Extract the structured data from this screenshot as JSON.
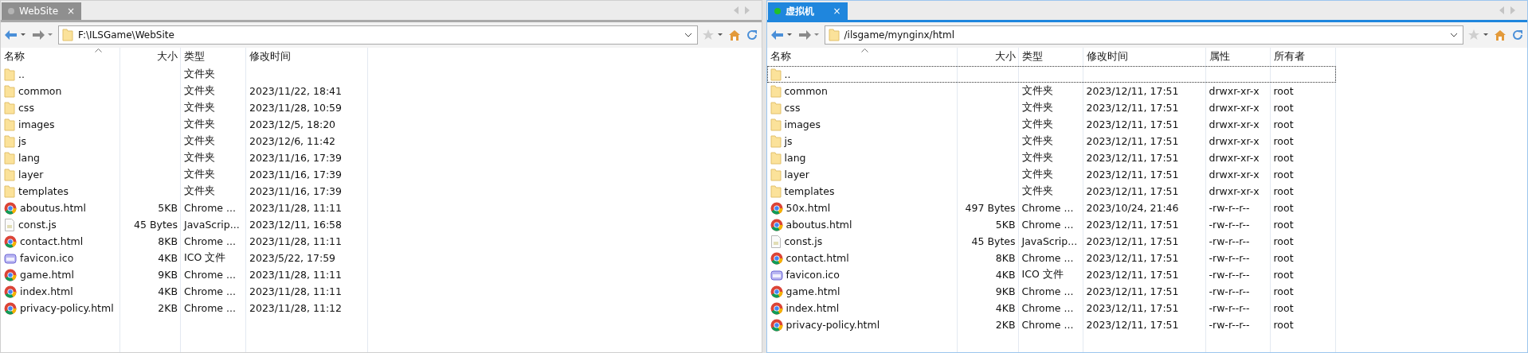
{
  "panels": [
    {
      "active": false,
      "tab": {
        "label": "WebSite",
        "color": "#b4b4b4",
        "close": "×"
      },
      "path": "F:\\ILSGame\\WebSite",
      "columns": [
        {
          "label": "名称",
          "sorted": true
        },
        {
          "label": "大小",
          "sorted": false
        },
        {
          "label": "类型",
          "sorted": false
        },
        {
          "label": "修改时间",
          "sorted": false
        }
      ],
      "rows": [
        {
          "kind": "folder",
          "name": "..",
          "type": "文件夹",
          "focused": false
        },
        {
          "kind": "folder",
          "name": "common",
          "type": "文件夹",
          "modified": "2023/11/22, 18:41",
          "focused": false
        },
        {
          "kind": "folder",
          "name": "css",
          "type": "文件夹",
          "modified": "2023/11/28, 10:59",
          "focused": false
        },
        {
          "kind": "folder",
          "name": "images",
          "type": "文件夹",
          "modified": "2023/12/5, 18:20",
          "focused": false
        },
        {
          "kind": "folder",
          "name": "js",
          "type": "文件夹",
          "modified": "2023/12/6, 11:42",
          "focused": false
        },
        {
          "kind": "folder",
          "name": "lang",
          "type": "文件夹",
          "modified": "2023/11/16, 17:39",
          "focused": false
        },
        {
          "kind": "folder",
          "name": "layer",
          "type": "文件夹",
          "modified": "2023/11/16, 17:39",
          "focused": false
        },
        {
          "kind": "folder",
          "name": "templates",
          "type": "文件夹",
          "modified": "2023/11/16, 17:39",
          "focused": false
        },
        {
          "kind": "chrome",
          "name": "aboutus.html",
          "size": "5KB",
          "type": "Chrome ...",
          "modified": "2023/11/28, 11:11",
          "focused": false
        },
        {
          "kind": "js",
          "name": "const.js",
          "size": "45 Bytes",
          "type": "JavaScrip...",
          "modified": "2023/12/11, 16:58",
          "focused": false
        },
        {
          "kind": "chrome",
          "name": "contact.html",
          "size": "8KB",
          "type": "Chrome ...",
          "modified": "2023/11/28, 11:11",
          "focused": false
        },
        {
          "kind": "ico",
          "name": "favicon.ico",
          "size": "4KB",
          "type": "ICO 文件",
          "modified": "2023/5/22, 17:59",
          "focused": false
        },
        {
          "kind": "chrome",
          "name": "game.html",
          "size": "9KB",
          "type": "Chrome ...",
          "modified": "2023/11/28, 11:11",
          "focused": false
        },
        {
          "kind": "chrome",
          "name": "index.html",
          "size": "4KB",
          "type": "Chrome ...",
          "modified": "2023/11/28, 11:11",
          "focused": false
        },
        {
          "kind": "chrome",
          "name": "privacy-policy.html",
          "size": "2KB",
          "type": "Chrome ...",
          "modified": "2023/11/28, 11:12",
          "focused": false
        }
      ]
    },
    {
      "active": true,
      "tab": {
        "label": "虚拟机",
        "color": "#22c02a",
        "close": "×"
      },
      "path": "/ilsgame/mynginx/html",
      "columns": [
        {
          "label": "名称",
          "sorted": true
        },
        {
          "label": "大小",
          "sorted": false
        },
        {
          "label": "类型",
          "sorted": false
        },
        {
          "label": "修改时间",
          "sorted": false
        },
        {
          "label": "属性",
          "sorted": false
        },
        {
          "label": "所有者",
          "sorted": false
        }
      ],
      "rows": [
        {
          "kind": "folder",
          "name": "..",
          "focused": true
        },
        {
          "kind": "folder",
          "name": "common",
          "type": "文件夹",
          "modified": "2023/12/11, 17:51",
          "permissions": "drwxr-xr-x",
          "owner": "root",
          "focused": false
        },
        {
          "kind": "folder",
          "name": "css",
          "type": "文件夹",
          "modified": "2023/12/11, 17:51",
          "permissions": "drwxr-xr-x",
          "owner": "root",
          "focused": false
        },
        {
          "kind": "folder",
          "name": "images",
          "type": "文件夹",
          "modified": "2023/12/11, 17:51",
          "permissions": "drwxr-xr-x",
          "owner": "root",
          "focused": false
        },
        {
          "kind": "folder",
          "name": "js",
          "type": "文件夹",
          "modified": "2023/12/11, 17:51",
          "permissions": "drwxr-xr-x",
          "owner": "root",
          "focused": false
        },
        {
          "kind": "folder",
          "name": "lang",
          "type": "文件夹",
          "modified": "2023/12/11, 17:51",
          "permissions": "drwxr-xr-x",
          "owner": "root",
          "focused": false
        },
        {
          "kind": "folder",
          "name": "layer",
          "type": "文件夹",
          "modified": "2023/12/11, 17:51",
          "permissions": "drwxr-xr-x",
          "owner": "root",
          "focused": false
        },
        {
          "kind": "folder",
          "name": "templates",
          "type": "文件夹",
          "modified": "2023/12/11, 17:51",
          "permissions": "drwxr-xr-x",
          "owner": "root",
          "focused": false
        },
        {
          "kind": "chrome",
          "name": "50x.html",
          "size": "497 Bytes",
          "type": "Chrome ...",
          "modified": "2023/10/24, 21:46",
          "permissions": "-rw-r--r--",
          "owner": "root",
          "focused": false
        },
        {
          "kind": "chrome",
          "name": "aboutus.html",
          "size": "5KB",
          "type": "Chrome ...",
          "modified": "2023/12/11, 17:51",
          "permissions": "-rw-r--r--",
          "owner": "root",
          "focused": false
        },
        {
          "kind": "js",
          "name": "const.js",
          "size": "45 Bytes",
          "type": "JavaScrip...",
          "modified": "2023/12/11, 17:51",
          "permissions": "-rw-r--r--",
          "owner": "root",
          "focused": false
        },
        {
          "kind": "chrome",
          "name": "contact.html",
          "size": "8KB",
          "type": "Chrome ...",
          "modified": "2023/12/11, 17:51",
          "permissions": "-rw-r--r--",
          "owner": "root",
          "focused": false
        },
        {
          "kind": "ico",
          "name": "favicon.ico",
          "size": "4KB",
          "type": "ICO 文件",
          "modified": "2023/12/11, 17:51",
          "permissions": "-rw-r--r--",
          "owner": "root",
          "focused": false
        },
        {
          "kind": "chrome",
          "name": "game.html",
          "size": "9KB",
          "type": "Chrome ...",
          "modified": "2023/12/11, 17:51",
          "permissions": "-rw-r--r--",
          "owner": "root",
          "focused": false
        },
        {
          "kind": "chrome",
          "name": "index.html",
          "size": "4KB",
          "type": "Chrome ...",
          "modified": "2023/12/11, 17:51",
          "permissions": "-rw-r--r--",
          "owner": "root",
          "focused": false
        },
        {
          "kind": "chrome",
          "name": "privacy-policy.html",
          "size": "2KB",
          "type": "Chrome ...",
          "modified": "2023/12/11, 17:51",
          "permissions": "-rw-r--r--",
          "owner": "root",
          "focused": false
        }
      ]
    }
  ]
}
